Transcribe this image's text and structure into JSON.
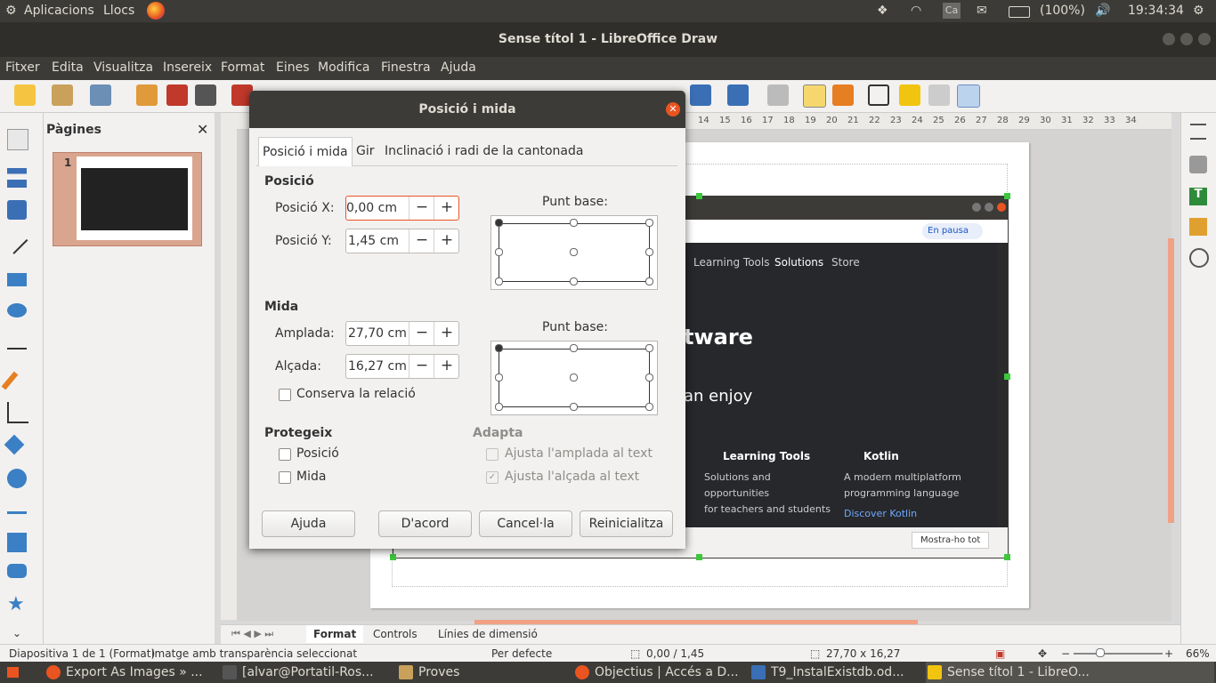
{
  "top_panel": {
    "apps_label": "Aplicacions",
    "places_label": "Llocs",
    "keyboard_label": "Ca",
    "battery": "(100%)",
    "clock": "19:34:34"
  },
  "window": {
    "title": "Sense títol 1 - LibreOffice Draw"
  },
  "menu": [
    "Fitxer",
    "Edita",
    "Visualitza",
    "Insereix",
    "Format",
    "Eines",
    "Modifica",
    "Finestra",
    "Ajuda"
  ],
  "pages_pane": {
    "title": "Pàgines",
    "page_number": "1"
  },
  "ruler_numbers": [
    "14",
    "15",
    "16",
    "17",
    "18",
    "19",
    "20",
    "21",
    "22",
    "23",
    "24",
    "25",
    "26",
    "27",
    "28",
    "29",
    "30",
    "31",
    "32",
    "33",
    "34"
  ],
  "embedded_browser": {
    "nav": [
      "Learning Tools",
      "Solutions",
      "Store"
    ],
    "pause_label": "En pausa",
    "heading_frag": "tware",
    "sub_frag": "an enjoy",
    "card1_title": "Learning Tools",
    "card1_text": [
      "Solutions and",
      "opportunities",
      "for teachers and students"
    ],
    "card2_title": "Kotlin",
    "card2_text": [
      "A modern multiplatform",
      "programming language"
    ],
    "card2_link": "Discover Kotlin",
    "show_all": "Mostra-ho tot"
  },
  "dialog": {
    "title": "Posició i mida",
    "tabs": [
      "Posició i mida",
      "Gir",
      "Inclinació i radi de la cantonada"
    ],
    "position_section": "Posició",
    "pos_x_label": "Posició X:",
    "pos_x_value": "0,00 cm",
    "pos_y_label": "Posició Y:",
    "pos_y_value": "1,45 cm",
    "base_point_label": "Punt base:",
    "size_section": "Mida",
    "width_label": "Amplada:",
    "width_value": "27,70 cm",
    "height_label": "Alçada:",
    "height_value": "16,27 cm",
    "keep_ratio": "Conserva la relació",
    "protect_section": "Protegeix",
    "protect_position": "Posició",
    "protect_size": "Mida",
    "adapt_section": "Adapta",
    "fit_width": "Ajusta l'amplada al text",
    "fit_height": "Ajusta l'alçada al text",
    "buttons": {
      "help": "Ajuda",
      "ok": "D'acord",
      "cancel": "Cancel·la",
      "reset": "Reinicialitza"
    },
    "minus_glyph": "−",
    "plus_glyph": "+"
  },
  "sheet_tabs": [
    "Format",
    "Controls",
    "Línies de dimensió"
  ],
  "status": {
    "slide": "Diapositiva 1 de 1 (Format)",
    "selection": "Imatge amb transparència seleccionat",
    "master": "Per defecte",
    "position": "0,00 / 1,45",
    "size": "27,70 x 16,27",
    "zoom": "66%"
  },
  "taskbar": [
    "Export As Images » ...",
    "[alvar@Portatil-Ros...",
    "Proves",
    "Objectius | Accés a D...",
    "T9_InstalExistdb.od...",
    "Sense títol 1 - LibreO..."
  ],
  "colors": {
    "accent": "#e95420",
    "panel": "#3c3b37",
    "handle": "#3dc73d"
  }
}
